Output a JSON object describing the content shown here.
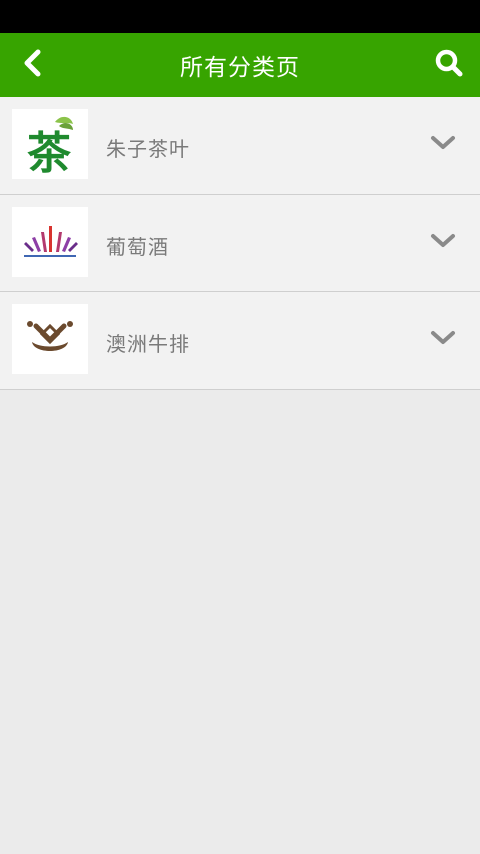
{
  "header": {
    "title": "所有分类页",
    "back_icon": "chevron-left-icon",
    "search_icon": "search-icon",
    "accent_color": "#37a400"
  },
  "categories": [
    {
      "label": "朱子茶叶",
      "logo_text": "茶",
      "logo_color": "#1f8a2e"
    },
    {
      "label": "葡萄酒",
      "logo_icon": "wine-bottles-logo"
    },
    {
      "label": "澳洲牛排",
      "logo_icon": "steak-logo"
    }
  ]
}
